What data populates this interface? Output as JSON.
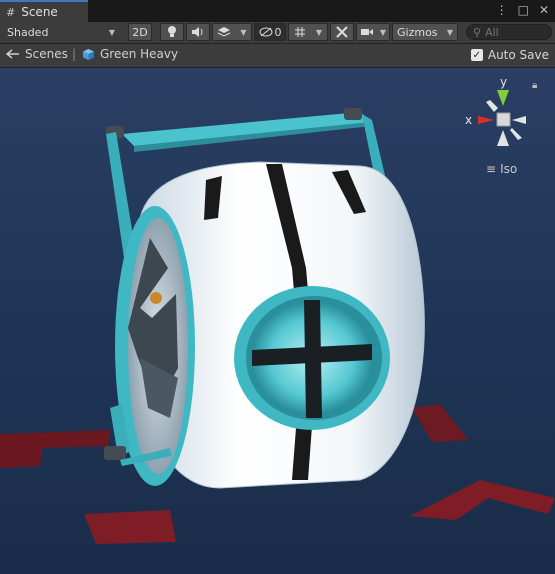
{
  "tab": {
    "icon": "grid-icon",
    "label": "Scene"
  },
  "window_buttons": [
    "⋮",
    "□",
    "✕"
  ],
  "toolbar": {
    "shading_mode": "Shaded",
    "mode_2d": "2D",
    "hidden_count": "0",
    "gizmos": "Gizmos",
    "search_placeholder": "All"
  },
  "breadcrumb": {
    "scenes_label": "Scenes",
    "separator": "|",
    "object_label": "Green Heavy"
  },
  "autosave": {
    "label": "Auto Save",
    "checked": true
  },
  "axis_gizmo": {
    "x_label": "x",
    "y_label": "y",
    "projection": "Iso"
  },
  "colors": {
    "viewport_bg": "#1f3556",
    "accent_teal": "#42c2cc",
    "body_white": "#eef3f6",
    "floor_red": "#7a1b22",
    "axis_x": "#d8312a",
    "axis_y": "#7fcf3a"
  }
}
